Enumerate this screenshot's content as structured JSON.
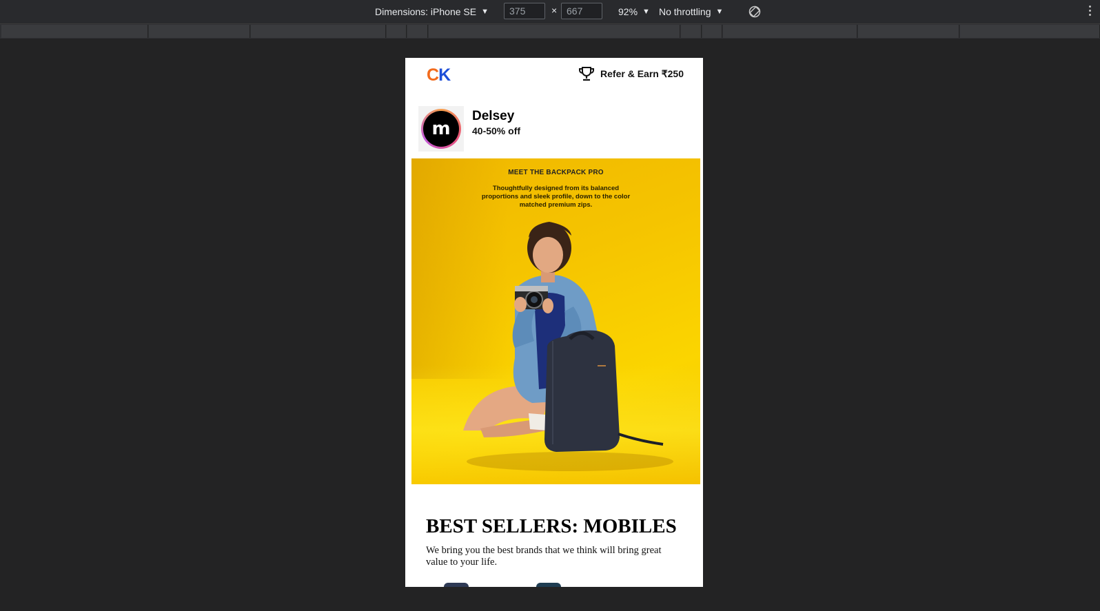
{
  "devtools": {
    "device_label": "Dimensions: iPhone SE",
    "width_value": "375",
    "height_value": "667",
    "times_symbol": "×",
    "zoom": "92%",
    "throttling": "No throttling",
    "icons": [
      "caret-down-icon",
      "rotate-icon",
      "more-vertical-icon"
    ]
  },
  "page": {
    "logo": {
      "c": "C",
      "k": "K"
    },
    "refer_label": "Refer & Earn ₹250",
    "brand": {
      "logo_letter": "m",
      "name": "Delsey",
      "offer": "40-50% off"
    },
    "banner": {
      "title": "MEET THE BACKPACK PRO",
      "description": "Thoughtfully designed from its balanced proportions and sleek profile, down to the color matched premium zips."
    },
    "section": {
      "heading": "BEST SELLERS: MOBILES",
      "text": "We bring you the best brands that we think will bring great value to your life."
    }
  },
  "colors": {
    "devtools_bg": "#232324",
    "toolbar_bg": "#292a2d",
    "logo_orange": "#f26b1d",
    "logo_blue": "#1d4ed8",
    "banner_yellow": "#f5c400"
  }
}
